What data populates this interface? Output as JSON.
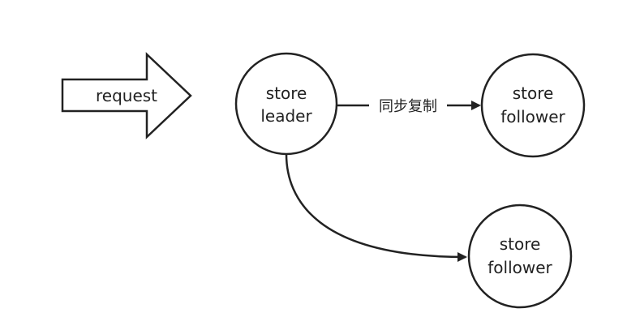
{
  "diagram": {
    "request_arrow": {
      "label": "request"
    },
    "nodes": {
      "leader": {
        "line1": "store",
        "line2": "leader"
      },
      "follower_top": {
        "line1": "store",
        "line2": "follower"
      },
      "follower_bottom": {
        "line1": "store",
        "line2": "follower"
      }
    },
    "edges": {
      "leader_to_follower_top": {
        "label": "同步复制"
      },
      "leader_to_follower_bottom": {
        "label": ""
      }
    },
    "colors": {
      "stroke": "#222222",
      "fill": "#ffffff",
      "text": "#222222"
    }
  }
}
